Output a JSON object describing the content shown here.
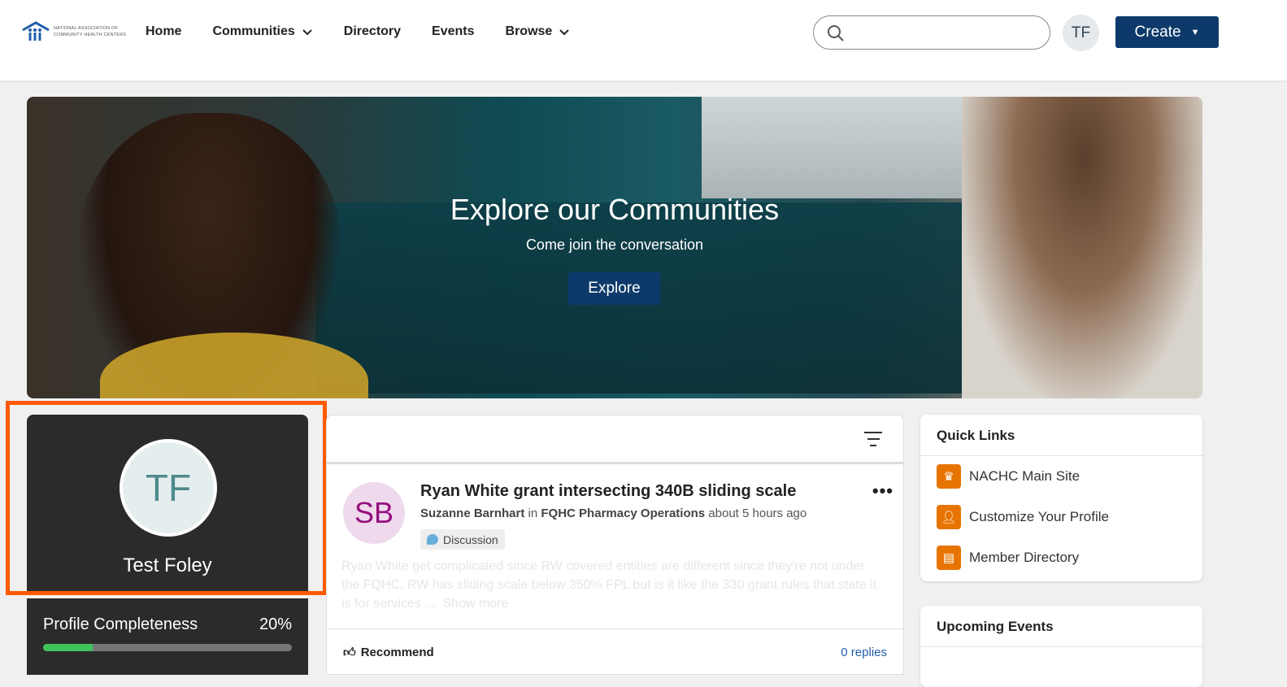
{
  "header": {
    "logo_text": "NATIONAL ASSOCIATION OF COMMUNITY HEALTH CENTERS",
    "nav": [
      {
        "label": "Home"
      },
      {
        "label": "Communities",
        "dropdown": true
      },
      {
        "label": "Directory"
      },
      {
        "label": "Events"
      },
      {
        "label": "Browse",
        "dropdown": true
      }
    ],
    "search": {
      "placeholder": "",
      "value": ""
    },
    "user_initials": "TF",
    "create_label": "Create"
  },
  "hero": {
    "title": "Explore our Communities",
    "subtitle": "Come join the conversation",
    "button": "Explore"
  },
  "profile": {
    "initials": "TF",
    "name": "Test Foley",
    "completeness_label": "Profile Completeness",
    "completeness_value": "20%",
    "completeness_fraction": 0.2
  },
  "feed": {
    "posts": [
      {
        "initials": "SB",
        "title": "Ryan White grant intersecting 340B sliding scale",
        "author": "Suzanne Barnhart",
        "in": "in",
        "community": "FQHC Pharmacy Operations",
        "time": "about 5 hours ago",
        "tag": "Discussion",
        "body": "Ryan White get complicated since RW covered entities are different since they're not under the FQHC. RW has sliding scale below 350% FPL but is it like the 330 grant rules that state it is for services ...",
        "show_more": "Show more",
        "recommend": "Recommend",
        "replies": "0 replies"
      }
    ]
  },
  "quick_links": {
    "title": "Quick Links",
    "items": [
      {
        "label": "NACHC Main Site",
        "icon": "crown-icon"
      },
      {
        "label": "Customize Your Profile",
        "icon": "user-icon"
      },
      {
        "label": "Member Directory",
        "icon": "address-book-icon"
      }
    ]
  },
  "upcoming_events": {
    "title": "Upcoming Events"
  },
  "colors": {
    "brand": "#0d3a6a",
    "accent": "#e77400",
    "highlight": "#ff5a00",
    "progress": "#3ec45a"
  }
}
